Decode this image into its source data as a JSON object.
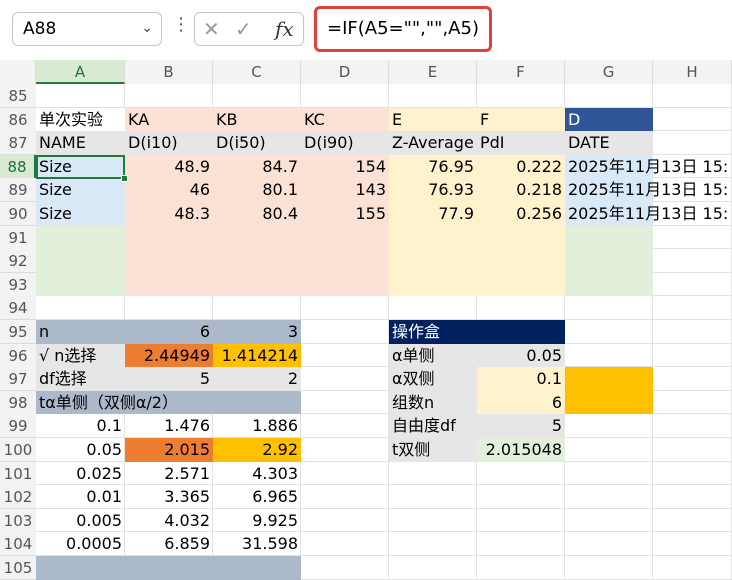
{
  "formula_bar": {
    "name_box": "A88",
    "cancel_icon": "✕",
    "confirm_icon": "✓",
    "fx_label": "fx",
    "formula": "=IF(A5=\"\",\"\",A5)"
  },
  "columns": [
    "A",
    "B",
    "C",
    "D",
    "E",
    "F",
    "G",
    "H"
  ],
  "rows": [
    "85",
    "86",
    "87",
    "88",
    "89",
    "90",
    "91",
    "92",
    "93",
    "94",
    "95",
    "96",
    "97",
    "98",
    "99",
    "100",
    "101",
    "102",
    "103",
    "104",
    "105"
  ],
  "selected_cell": "A88",
  "top_table": {
    "row86": [
      "单次实验",
      "KA",
      "KB",
      "KC",
      "E",
      "F",
      "D"
    ],
    "row87": [
      "NAME",
      "D(i10)",
      "D(i50)",
      "D(i90)",
      "Z-Average",
      "PdI",
      "DATE"
    ],
    "data": [
      [
        "Size",
        "48.9",
        "84.7",
        "154",
        "76.95",
        "0.222",
        "2025年11月13日 15:"
      ],
      [
        "Size",
        "46",
        "80.1",
        "143",
        "76.93",
        "0.218",
        "2025年11月13日 15:"
      ],
      [
        "Size",
        "48.3",
        "80.4",
        "155",
        "77.9",
        "0.256",
        "2025年11月13日 15:"
      ]
    ]
  },
  "left_table": {
    "n_label": "n",
    "n_b": "6",
    "n_c": "3",
    "sqrt_label": "√ n选择",
    "sqrt_b": "2.44949",
    "sqrt_c": "1.414214",
    "df_label": "df选择",
    "df_b": "5",
    "df_c": "2",
    "t_header": "tα单侧（双侧α/2）",
    "rows": [
      [
        "0.1",
        "1.476",
        "1.886"
      ],
      [
        "0.05",
        "2.015",
        "2.92"
      ],
      [
        "0.025",
        "2.571",
        "4.303"
      ],
      [
        "0.01",
        "3.365",
        "6.965"
      ],
      [
        "0.005",
        "4.032",
        "9.925"
      ],
      [
        "0.0005",
        "6.859",
        "31.598"
      ]
    ]
  },
  "op_box": {
    "title": "操作盒",
    "rows": [
      [
        "α单侧",
        "0.05"
      ],
      [
        "α双侧",
        "0.1"
      ],
      [
        "组数n",
        "6"
      ],
      [
        "自由度df",
        "5"
      ],
      [
        "t双侧",
        "2.015048"
      ]
    ]
  },
  "colors": {
    "header_blue": "#acb9ca",
    "peach": "#fbe2d5",
    "light_blue": "#dae9f8",
    "light_green": "#e2efda",
    "cream": "#fff2cc",
    "dark_blue": "#2f5597",
    "navy": "#002060",
    "orange": "#ed7d31",
    "gold": "#ffc000",
    "gray": "#e7e6e6"
  }
}
